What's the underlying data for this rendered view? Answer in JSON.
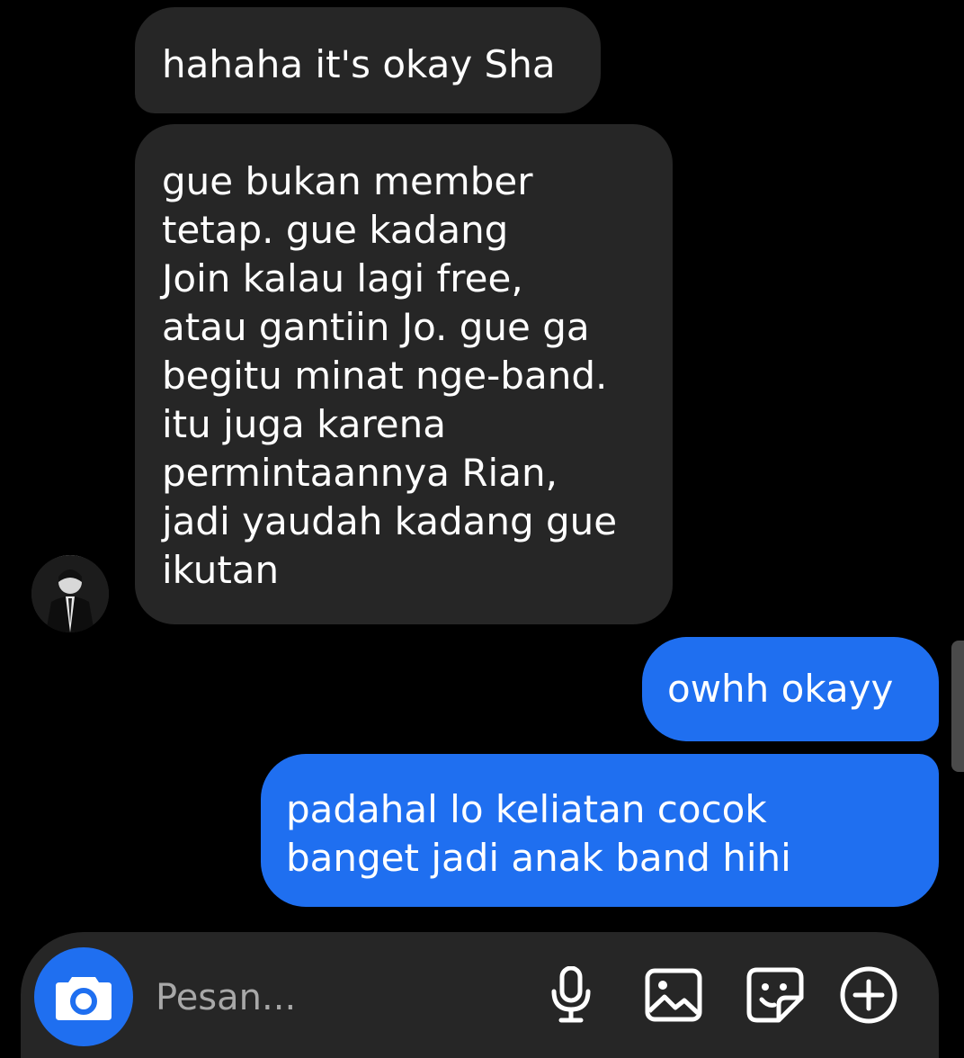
{
  "messages": [
    {
      "id": "msg-1",
      "sender": "other",
      "lines": [
        "hahaha it's okay Sha"
      ]
    },
    {
      "id": "msg-2",
      "sender": "other",
      "lines": [
        "gue bukan member",
        "tetap. gue kadang",
        "Join kalau lagi free,",
        "atau gantiin Jo. gue ga",
        "begitu minat nge-band.",
        "itu juga karena",
        "permintaannya Rian,",
        "jadi yaudah kadang gue",
        "ikutan"
      ]
    },
    {
      "id": "msg-3",
      "sender": "me",
      "lines": [
        "owhh okayy"
      ]
    },
    {
      "id": "msg-4",
      "sender": "me",
      "lines": [
        "padahal lo keliatan cocok",
        "banget jadi anak band hihi"
      ]
    }
  ],
  "composer": {
    "placeholder": "Pesan...",
    "value": "",
    "icons": [
      "camera-icon",
      "microphone-icon",
      "gallery-icon",
      "sticker-icon",
      "plus-icon"
    ]
  },
  "colors": {
    "background": "#000000",
    "incoming_bubble": "#262626",
    "outgoing_bubble": "#1f6ff0",
    "text": "#ffffff",
    "placeholder": "#a8a8a8"
  }
}
